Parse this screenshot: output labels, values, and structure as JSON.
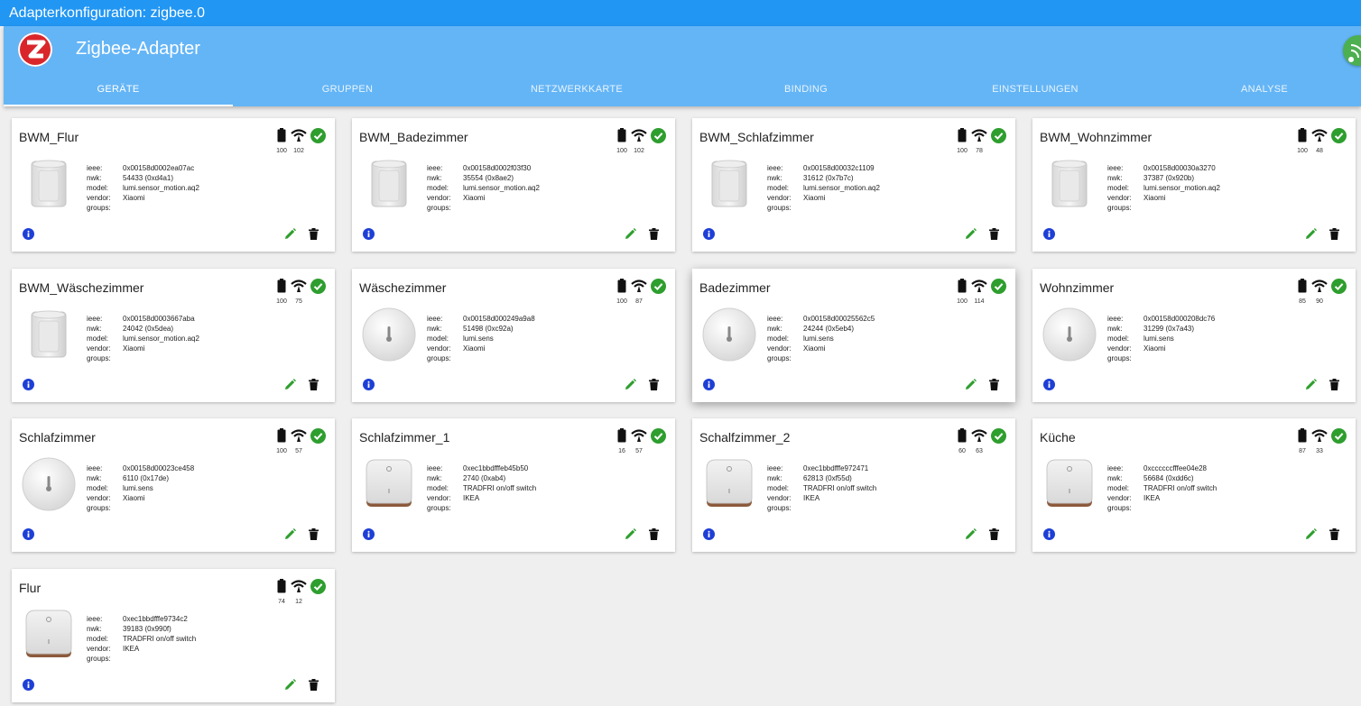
{
  "window": {
    "title": "Adapterkonfiguration: zigbee.0"
  },
  "header": {
    "title": "Zigbee-Adapter"
  },
  "tabs": [
    {
      "label": "GERÄTE",
      "active": true
    },
    {
      "label": "GRUPPEN",
      "active": false
    },
    {
      "label": "NETZWERKKARTE",
      "active": false
    },
    {
      "label": "BINDING",
      "active": false
    },
    {
      "label": "EINSTELLUNGEN",
      "active": false
    },
    {
      "label": "ANALYSE",
      "active": false
    }
  ],
  "labels": {
    "ieee": "ieee:",
    "nwk": "nwk:",
    "model": "model:",
    "vendor": "vendor:",
    "groups": "groups:"
  },
  "colors": {
    "titlebar": "#2196f3",
    "appbar": "#64b5f6",
    "ok": "#2e9e2e",
    "info": "#1e3fd6",
    "edit": "#2e9e2e"
  },
  "icons": {
    "battery": "battery-icon",
    "signal": "signal-icon",
    "online": "check-circle-icon",
    "info": "info-icon",
    "edit": "pencil-icon",
    "delete": "trash-icon"
  },
  "devices": [
    {
      "name": "BWM_Flur",
      "battery": "100",
      "lqi": "102",
      "ieee": "0x00158d0002ea07ac",
      "nwk": "54433 (0xd4a1)",
      "model": "lumi.sensor_motion.aq2",
      "vendor": "Xiaomi",
      "groups": "",
      "image": "motion-sensor"
    },
    {
      "name": "BWM_Badezimmer",
      "battery": "100",
      "lqi": "102",
      "ieee": "0x00158d0002f03f30",
      "nwk": "35554 (0x8ae2)",
      "model": "lumi.sensor_motion.aq2",
      "vendor": "Xiaomi",
      "groups": "",
      "image": "motion-sensor"
    },
    {
      "name": "BWM_Schlafzimmer",
      "battery": "100",
      "lqi": "78",
      "ieee": "0x00158d00032c1109",
      "nwk": "31612 (0x7b7c)",
      "model": "lumi.sensor_motion.aq2",
      "vendor": "Xiaomi",
      "groups": "",
      "image": "motion-sensor"
    },
    {
      "name": "BWM_Wohnzimmer",
      "battery": "100",
      "lqi": "48",
      "ieee": "0x00158d00030a3270",
      "nwk": "37387 (0x920b)",
      "model": "lumi.sensor_motion.aq2",
      "vendor": "Xiaomi",
      "groups": "",
      "image": "motion-sensor"
    },
    {
      "name": "BWM_Wäschezimmer",
      "battery": "100",
      "lqi": "75",
      "ieee": "0x00158d0003667aba",
      "nwk": "24042 (0x5dea)",
      "model": "lumi.sensor_motion.aq2",
      "vendor": "Xiaomi",
      "groups": "",
      "image": "motion-sensor"
    },
    {
      "name": "Wäschezimmer",
      "battery": "100",
      "lqi": "87",
      "ieee": "0x00158d000249a9a8",
      "nwk": "51498 (0xc92a)",
      "model": "lumi.sens",
      "vendor": "Xiaomi",
      "groups": "",
      "image": "temp-sensor"
    },
    {
      "name": "Badezimmer",
      "battery": "100",
      "lqi": "114",
      "ieee": "0x00158d00025562c5",
      "nwk": "24244 (0x5eb4)",
      "model": "lumi.sens",
      "vendor": "Xiaomi",
      "groups": "",
      "image": "temp-sensor"
    },
    {
      "name": "Wohnzimmer",
      "battery": "85",
      "lqi": "90",
      "ieee": "0x00158d000208dc76",
      "nwk": "31299 (0x7a43)",
      "model": "lumi.sens",
      "vendor": "Xiaomi",
      "groups": "",
      "image": "temp-sensor"
    },
    {
      "name": "Schlafzimmer",
      "battery": "100",
      "lqi": "57",
      "ieee": "0x00158d00023ce458",
      "nwk": "6110 (0x17de)",
      "model": "lumi.sens",
      "vendor": "Xiaomi",
      "groups": "",
      "image": "temp-sensor"
    },
    {
      "name": "Schlafzimmer_1",
      "battery": "16",
      "lqi": "57",
      "ieee": "0xec1bbdfffeb45b50",
      "nwk": "2740 (0xab4)",
      "model": "TRADFRI on/off switch",
      "vendor": "IKEA",
      "groups": "",
      "image": "switch"
    },
    {
      "name": "Schalfzimmer_2",
      "battery": "60",
      "lqi": "63",
      "ieee": "0xec1bbdfffe972471",
      "nwk": "62813 (0xf55d)",
      "model": "TRADFRI on/off switch",
      "vendor": "IKEA",
      "groups": "",
      "image": "switch"
    },
    {
      "name": "Küche",
      "battery": "87",
      "lqi": "33",
      "ieee": "0xccccccfffee04e28",
      "nwk": "56684 (0xdd6c)",
      "model": "TRADFRI on/off switch",
      "vendor": "IKEA",
      "groups": "",
      "image": "switch"
    },
    {
      "name": "Flur",
      "battery": "74",
      "lqi": "12",
      "ieee": "0xec1bbdfffe9734c2",
      "nwk": "39183 (0x990f)",
      "model": "TRADFRI on/off switch",
      "vendor": "IKEA",
      "groups": "",
      "image": "switch"
    }
  ]
}
